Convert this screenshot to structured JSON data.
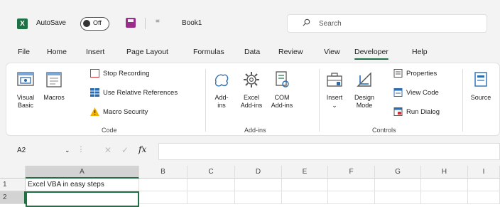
{
  "titlebar": {
    "autosave_label": "AutoSave",
    "autosave_state": "Off",
    "book_title": "Book1",
    "qat_more": "=",
    "search_placeholder": "Search"
  },
  "tabs": [
    "File",
    "Home",
    "Insert",
    "Page Layout",
    "Formulas",
    "Data",
    "Review",
    "View",
    "Developer",
    "Help"
  ],
  "active_tab": "Developer",
  "ribbon": {
    "code": {
      "label": "Code",
      "visual_basic": "Visual\nBasic",
      "macros": "Macros",
      "stop_recording": "Stop Recording",
      "relative_refs": "Use Relative References",
      "macro_security": "Macro Security"
    },
    "addins": {
      "label": "Add-ins",
      "addins": "Add-\nins",
      "excel_addins": "Excel\nAdd-ins",
      "com_addins": "COM\nAdd-ins"
    },
    "controls": {
      "label": "Controls",
      "insert": "Insert",
      "insert_chev": "⌄",
      "design_mode": "Design\nMode",
      "properties": "Properties",
      "view_code": "View Code",
      "run_dialog": "Run Dialog"
    },
    "xml": {
      "source": "Source"
    }
  },
  "formula_bar": {
    "name_box": "A2",
    "chevron": "⌄",
    "dots": "⋮",
    "cancel": "✕",
    "enter": "✓",
    "fx": "fx",
    "value": ""
  },
  "grid": {
    "columns": [
      "A",
      "B",
      "C",
      "D",
      "E",
      "F",
      "G",
      "H",
      "I"
    ],
    "rows": [
      "1",
      "2"
    ],
    "A1": "Excel VBA in easy steps"
  },
  "colors": {
    "excel_green": "#1e7145",
    "save_purple": "#9a2d8a",
    "ribbon_blue": "#2b6cb0",
    "alert_red": "#d13438",
    "warning_yellow": "#f2b300"
  }
}
